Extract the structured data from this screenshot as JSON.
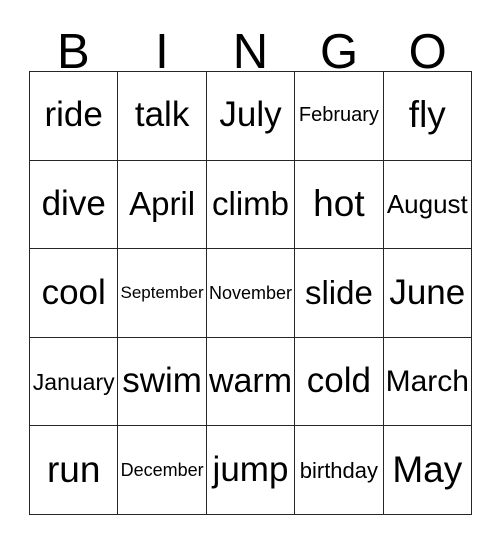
{
  "card": {
    "title": "BINGO",
    "header_letters": [
      "B",
      "I",
      "N",
      "G",
      "O"
    ],
    "colors": {
      "grid_line": "#262626",
      "text": "#000000",
      "background": "#ffffff"
    },
    "grid": {
      "rows": 5,
      "columns": 5,
      "cells": [
        [
          {
            "text": "ride"
          },
          {
            "text": "talk"
          },
          {
            "text": "July"
          },
          {
            "text": "February"
          },
          {
            "text": "fly"
          }
        ],
        [
          {
            "text": "dive"
          },
          {
            "text": "April"
          },
          {
            "text": "climb"
          },
          {
            "text": "hot"
          },
          {
            "text": "August"
          }
        ],
        [
          {
            "text": "cool"
          },
          {
            "text": "September"
          },
          {
            "text": "November"
          },
          {
            "text": "slide"
          },
          {
            "text": "June"
          }
        ],
        [
          {
            "text": "January"
          },
          {
            "text": "swim"
          },
          {
            "text": "warm"
          },
          {
            "text": "cold"
          },
          {
            "text": "March"
          }
        ],
        [
          {
            "text": "run"
          },
          {
            "text": "December"
          },
          {
            "text": "jump"
          },
          {
            "text": "birthday"
          },
          {
            "text": "May"
          }
        ]
      ]
    }
  }
}
